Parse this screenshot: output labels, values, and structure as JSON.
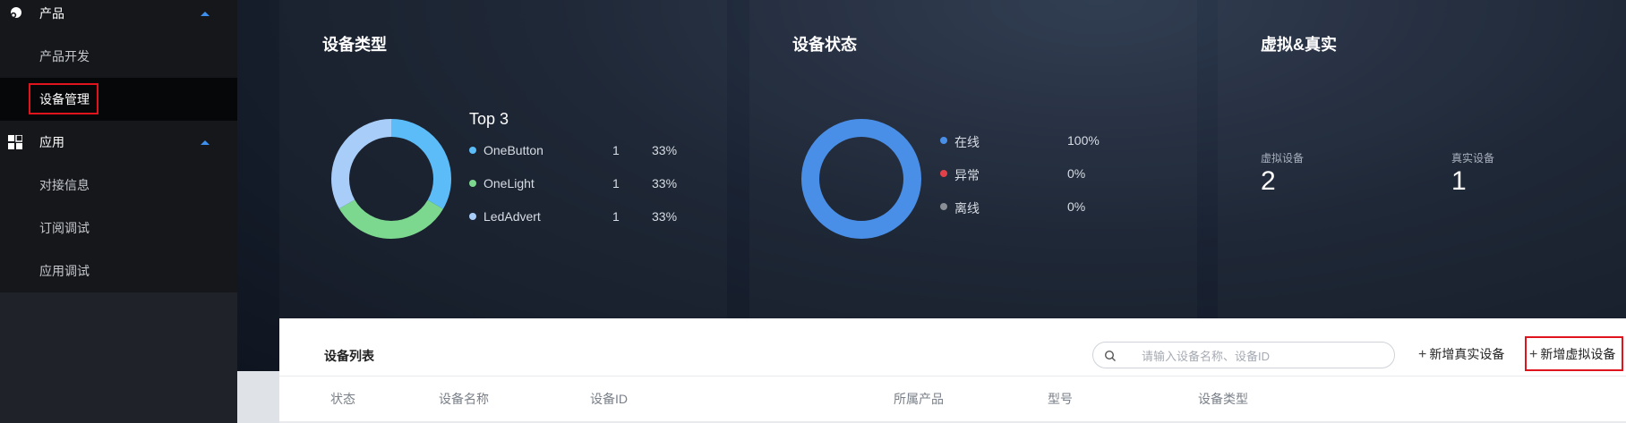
{
  "sidebar": {
    "groups": [
      {
        "label": "产品",
        "icon": "product-icon",
        "items": [
          {
            "label": "产品开发"
          },
          {
            "label": "设备管理",
            "active": true
          }
        ]
      },
      {
        "label": "应用",
        "icon": "app-grid-icon",
        "items": [
          {
            "label": "对接信息"
          },
          {
            "label": "订阅调试"
          },
          {
            "label": "应用调试"
          }
        ]
      }
    ]
  },
  "device_type": {
    "title": "设备类型",
    "subtitle": "Top 3",
    "legend": [
      {
        "name": "OneButton",
        "count": "1",
        "percent": "33%",
        "color": "#5bbcf8"
      },
      {
        "name": "OneLight",
        "count": "1",
        "percent": "33%",
        "color": "#7dd88f"
      },
      {
        "name": "LedAdvert",
        "count": "1",
        "percent": "33%",
        "color": "#a9cdf9"
      }
    ],
    "chart_data": {
      "type": "pie",
      "categories": [
        "OneButton",
        "OneLight",
        "LedAdvert"
      ],
      "values": [
        1,
        1,
        1
      ],
      "colors": [
        "#5bbcf8",
        "#7dd88f",
        "#a9cdf9"
      ]
    }
  },
  "device_status": {
    "title": "设备状态",
    "legend": [
      {
        "name": "在线",
        "percent": "100%",
        "color": "#4a8fe7"
      },
      {
        "name": "异常",
        "percent": "0%",
        "color": "#e2414a"
      },
      {
        "name": "离线",
        "percent": "0%",
        "color": "#8a8f96"
      }
    ],
    "chart_data": {
      "type": "pie",
      "categories": [
        "在线",
        "异常",
        "离线"
      ],
      "values": [
        100,
        0,
        0
      ],
      "colors": [
        "#4a8fe7",
        "#e2414a",
        "#8a8f96"
      ]
    }
  },
  "virtual_real": {
    "title": "虚拟&真实",
    "virtual_label": "虚拟设备",
    "virtual_value": "2",
    "real_label": "真实设备",
    "real_value": "1"
  },
  "device_list": {
    "title": "设备列表",
    "search_placeholder": "请输入设备名称、设备ID",
    "add_real_label": "新增真实设备",
    "add_virtual_label": "新增虚拟设备",
    "columns": [
      "状态",
      "设备名称",
      "设备ID",
      "所属产品",
      "型号",
      "设备类型"
    ]
  },
  "colors": {
    "highlight": "#e0141c",
    "accent": "#3d8ff0"
  }
}
